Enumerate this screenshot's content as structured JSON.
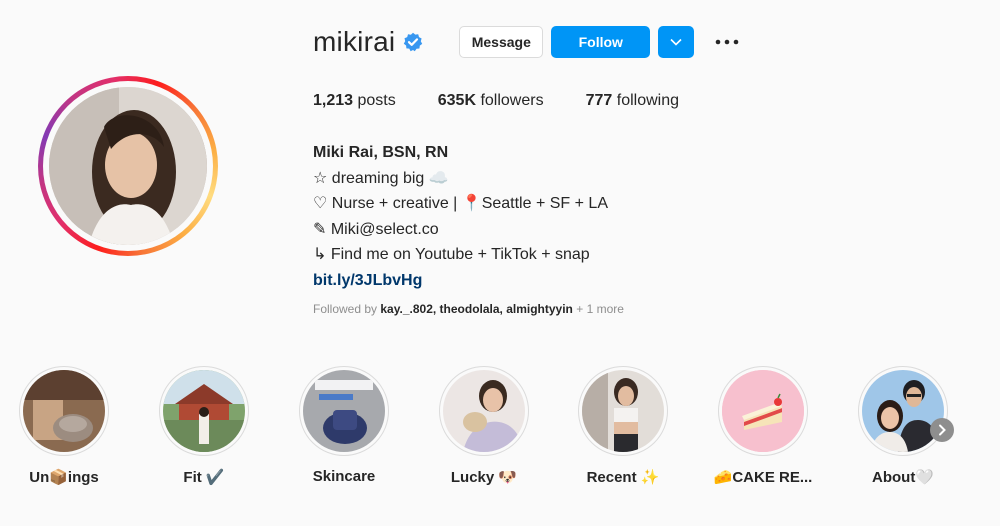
{
  "profile": {
    "username": "mikirai",
    "verified": true,
    "buttons": {
      "message": "Message",
      "follow": "Follow"
    },
    "stats": {
      "posts_count": "1,213",
      "posts_label": "posts",
      "followers_count": "635K",
      "followers_label": "followers",
      "following_count": "777",
      "following_label": "following"
    },
    "bio": {
      "name": "Miki Rai, BSN, RN",
      "lines": [
        "☆ dreaming big ☁️",
        "♡ Nurse + creative | 📍Seattle + SF + LA",
        "✎ Miki@select.co",
        "↳ Find me on Youtube + TikTok + snap"
      ],
      "link": "bit.ly/3JLbvHg"
    },
    "followed_by": {
      "prefix": "Followed by",
      "names": "kay._.802, theodolala, almightyyin",
      "suffix": "+ 1 more"
    }
  },
  "highlights": [
    {
      "label": "Un📦ings",
      "icon": "unboxing-photo"
    },
    {
      "label": "Fit ✔️",
      "icon": "fit-photo"
    },
    {
      "label": "Skincare",
      "icon": "skincare-photo"
    },
    {
      "label": "Lucky 🐶",
      "icon": "lucky-photo"
    },
    {
      "label": "Recent ✨",
      "icon": "recent-photo"
    },
    {
      "label": "🧀CAKE RE...",
      "icon": "cake-icon"
    },
    {
      "label": "About🤍",
      "icon": "about-photo"
    }
  ],
  "colors": {
    "follow_blue": "#0095f6",
    "link_blue": "#00376b",
    "verified_blue": "#0095f6"
  }
}
